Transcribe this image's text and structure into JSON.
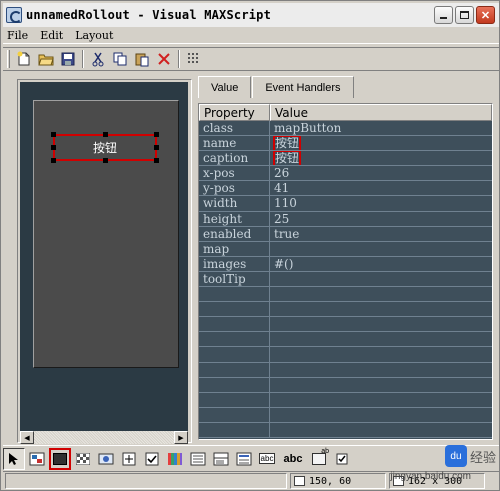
{
  "window": {
    "title": "unnamedRollout - Visual MAXScript",
    "minimize_label": "_",
    "maximize_label": "□",
    "close_label": "✕"
  },
  "menu": {
    "items": [
      {
        "label": "File"
      },
      {
        "label": "Edit"
      },
      {
        "label": "Layout"
      }
    ]
  },
  "toolbar": {
    "icons": [
      "new-icon",
      "open-icon",
      "save-icon",
      "cut-icon",
      "copy-icon",
      "paste-icon",
      "delete-icon",
      "grid-icon"
    ]
  },
  "canvas": {
    "button_caption": "按钮"
  },
  "properties": {
    "tabs": [
      {
        "label": "Value"
      },
      {
        "label": "Event Handlers"
      }
    ],
    "header": {
      "property": "Property",
      "value": "Value"
    },
    "rows": [
      {
        "property": "class",
        "value": "mapButton"
      },
      {
        "property": "name",
        "value": "按钮"
      },
      {
        "property": "caption",
        "value": "按钮"
      },
      {
        "property": "x-pos",
        "value": "26"
      },
      {
        "property": "y-pos",
        "value": "41"
      },
      {
        "property": "width",
        "value": "110"
      },
      {
        "property": "height",
        "value": "25"
      },
      {
        "property": "enabled",
        "value": "true"
      },
      {
        "property": "map",
        "value": ""
      },
      {
        "property": "images",
        "value": "#()"
      },
      {
        "property": "toolTip",
        "value": ""
      }
    ]
  },
  "controls_bar": {
    "abc_label": "abc",
    "abc_small_label": "abc",
    "ab_label": "ab"
  },
  "status": {
    "position": "150, 60",
    "size": "162 x 300"
  },
  "watermark": {
    "text": "经验",
    "url": "jingyan.baidu.com",
    "logo": "du"
  },
  "colors": {
    "highlight": "#d00000",
    "grid_bg": "#3e4f5b",
    "canvas_bg": "#4b4b4b"
  }
}
